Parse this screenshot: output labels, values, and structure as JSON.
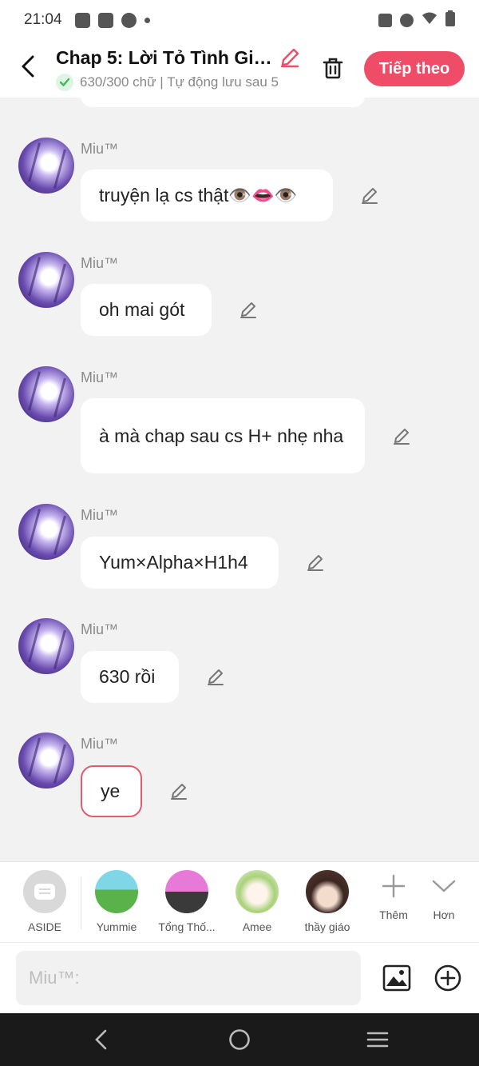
{
  "status_bar": {
    "time": "21:04"
  },
  "header": {
    "title": "Chap 5: Lời Tỏ Tình Giả...",
    "subtitle": "630/300 chữ | Tự động lưu sau 5",
    "next_label": "Tiếp theo"
  },
  "messages": [
    {
      "sender": "Miu™",
      "text": "truyện lạ cs thật👁️👄👁️"
    },
    {
      "sender": "Miu™",
      "text": "oh mai gót"
    },
    {
      "sender": "Miu™",
      "text": "à mà chap sau cs H+ nhẹ nha"
    },
    {
      "sender": "Miu™",
      "text": "Yum×Alpha×H1h4"
    },
    {
      "sender": "Miu™",
      "text": "630 rồi"
    },
    {
      "sender": "Miu™",
      "text": "ye"
    }
  ],
  "characters": [
    {
      "label": "ASIDE"
    },
    {
      "label": "Yummie"
    },
    {
      "label": "Tổng Thố..."
    },
    {
      "label": "Amee"
    },
    {
      "label": "thầy giáo"
    }
  ],
  "tools": {
    "add_label": "Thêm",
    "more_label": "Hơn"
  },
  "composer": {
    "placeholder": "Miu™:"
  },
  "colors": {
    "accent": "#ef4d67",
    "selected_border": "#e65a6e"
  }
}
